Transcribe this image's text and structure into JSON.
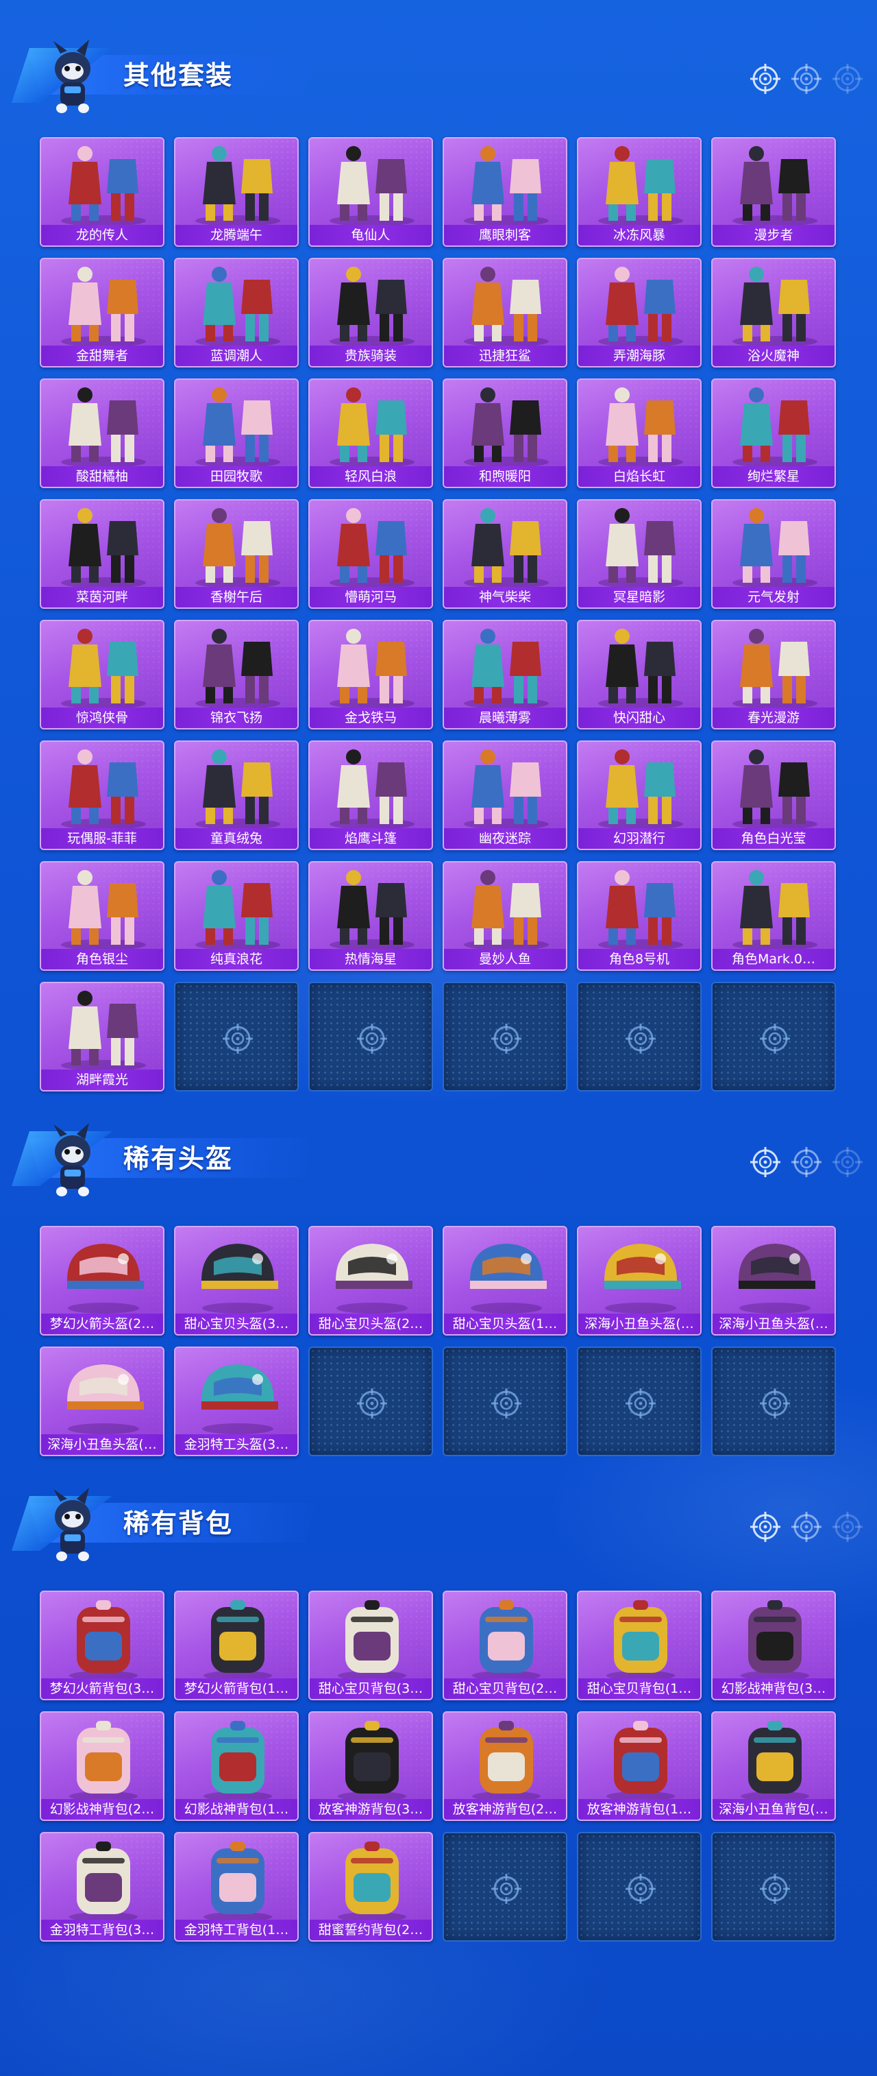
{
  "sections": [
    {
      "title": "其他套装",
      "items": [
        "龙的传人",
        "龙腾端午",
        "龟仙人",
        "鹰眼刺客",
        "冰冻风暴",
        "漫步者",
        "金甜舞者",
        "蓝调潮人",
        "贵族骑装",
        "迅捷狂鲨",
        "弄潮海豚",
        "浴火魔神",
        "酸甜橘柚",
        "田园牧歌",
        "轻风白浪",
        "和煦暖阳",
        "白焰长虹",
        "绚烂繁星",
        "菜茵河畔",
        "香榭午后",
        "懵萌河马",
        "神气柴柴",
        "冥星暗影",
        "元气发射",
        "惊鸿侠骨",
        "锦衣飞扬",
        "金戈铁马",
        "晨曦薄雾",
        "快闪甜心",
        "春光漫游",
        "玩偶服-菲菲",
        "童真绒兔",
        "焰鹰斗篷",
        "幽夜迷踪",
        "幻羽潜行",
        "角色白光莹",
        "角色银尘",
        "纯真浪花",
        "热情海星",
        "曼妙人鱼",
        "角色8号机",
        "角色Mark.0…",
        "湖畔霞光"
      ],
      "empty_slots": 5
    },
    {
      "title": "稀有头盔",
      "items": [
        "梦幻火箭头盔(2…",
        "甜心宝贝头盔(3…",
        "甜心宝贝头盔(2…",
        "甜心宝贝头盔(1…",
        "深海小丑鱼头盔(…",
        "深海小丑鱼头盔(…",
        "深海小丑鱼头盔(…",
        "金羽特工头盔(3…"
      ],
      "empty_slots": 4
    },
    {
      "title": "稀有背包",
      "items": [
        "梦幻火箭背包(3…",
        "梦幻火箭背包(1…",
        "甜心宝贝背包(3…",
        "甜心宝贝背包(2…",
        "甜心宝贝背包(1…",
        "幻影战神背包(3…",
        "幻影战神背包(2…",
        "幻影战神背包(1…",
        "放客神游背包(3…",
        "放客神游背包(2…",
        "放客神游背包(1…",
        "深海小丑鱼背包(…",
        "金羽特工背包(3…",
        "金羽特工背包(1…",
        "甜蜜誓约背包(2…"
      ],
      "empty_slots": 3
    }
  ],
  "icons": {
    "header_target": "crosshair-target-icon",
    "empty_slot": "crosshair-target-icon",
    "mascot": "mascot-character-icon"
  },
  "colors": {
    "background": "#1060dc",
    "card_purple": "#a655e6",
    "label_purple": "#7b22d8",
    "empty_slot": "#173f7a"
  }
}
